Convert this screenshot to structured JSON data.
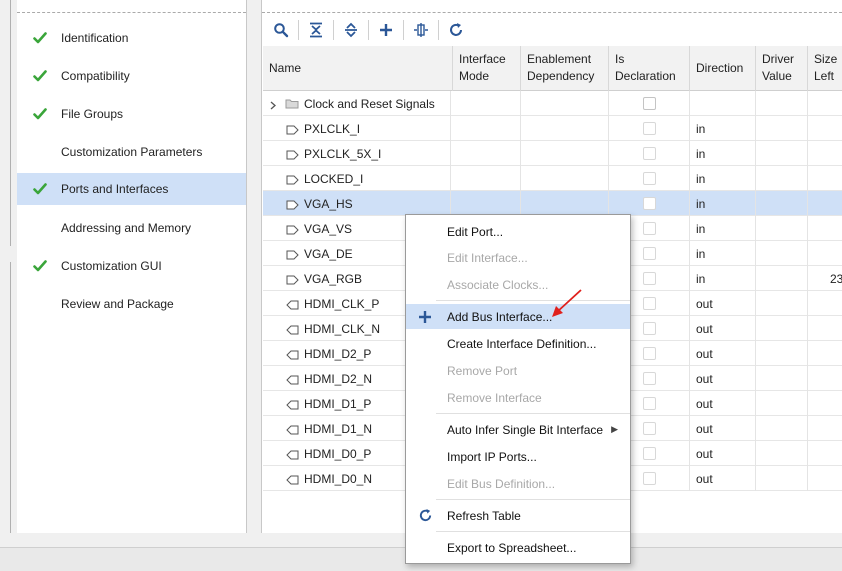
{
  "nav": {
    "items": [
      {
        "label": "Identification",
        "checked": true
      },
      {
        "label": "Compatibility",
        "checked": true
      },
      {
        "label": "File Groups",
        "checked": true
      },
      {
        "label": "Customization Parameters",
        "checked": false
      },
      {
        "label": "Ports and Interfaces",
        "checked": true,
        "selected": true
      },
      {
        "label": "Addressing and Memory",
        "checked": false
      },
      {
        "label": "Customization GUI",
        "checked": true
      },
      {
        "label": "Review and Package",
        "checked": false
      }
    ]
  },
  "toolbar": {
    "icons": [
      "search-icon",
      "collapse-all-icon",
      "expand-all-icon",
      "add-icon",
      "map-icon",
      "refresh-icon"
    ]
  },
  "table": {
    "headers": {
      "name": "Name",
      "interface_mode_1": "Interface",
      "interface_mode_2": "Mode",
      "enablement_1": "Enablement",
      "enablement_2": "Dependency",
      "is_decl_1": "Is",
      "is_decl_2": "Declaration",
      "direction": "Direction",
      "driver_1": "Driver",
      "driver_2": "Value",
      "size_1": "Size",
      "size_2": "Left"
    },
    "rows": [
      {
        "name": "Clock and Reset Signals",
        "kind": "group",
        "direction": "",
        "size_left": ""
      },
      {
        "name": "PXLCLK_I",
        "kind": "in",
        "direction": "in",
        "size_left": ""
      },
      {
        "name": "PXLCLK_5X_I",
        "kind": "in",
        "direction": "in",
        "size_left": ""
      },
      {
        "name": "LOCKED_I",
        "kind": "in",
        "direction": "in",
        "size_left": ""
      },
      {
        "name": "VGA_HS",
        "kind": "in",
        "direction": "in",
        "size_left": "",
        "selected": true
      },
      {
        "name": "VGA_VS",
        "kind": "in",
        "direction": "in",
        "size_left": ""
      },
      {
        "name": "VGA_DE",
        "kind": "in",
        "direction": "in",
        "size_left": ""
      },
      {
        "name": "VGA_RGB",
        "kind": "in",
        "direction": "in",
        "size_left": "23"
      },
      {
        "name": "HDMI_CLK_P",
        "kind": "out",
        "direction": "out",
        "size_left": ""
      },
      {
        "name": "HDMI_CLK_N",
        "kind": "out",
        "direction": "out",
        "size_left": ""
      },
      {
        "name": "HDMI_D2_P",
        "kind": "out",
        "direction": "out",
        "size_left": ""
      },
      {
        "name": "HDMI_D2_N",
        "kind": "out",
        "direction": "out",
        "size_left": ""
      },
      {
        "name": "HDMI_D1_P",
        "kind": "out",
        "direction": "out",
        "size_left": ""
      },
      {
        "name": "HDMI_D1_N",
        "kind": "out",
        "direction": "out",
        "size_left": ""
      },
      {
        "name": "HDMI_D0_P",
        "kind": "out",
        "direction": "out",
        "size_left": ""
      },
      {
        "name": "HDMI_D0_N",
        "kind": "out",
        "direction": "out",
        "size_left": ""
      }
    ]
  },
  "menu": {
    "edit_port": "Edit Port...",
    "edit_interface": "Edit Interface...",
    "associate_clocks": "Associate Clocks...",
    "add_bus_interface": "Add Bus Interface...",
    "create_interface_definition": "Create Interface Definition...",
    "remove_port": "Remove Port",
    "remove_interface": "Remove Interface",
    "auto_infer": "Auto Infer Single Bit Interface",
    "import_ip_ports": "Import IP Ports...",
    "edit_bus_definition": "Edit Bus Definition...",
    "refresh_table": "Refresh Table",
    "export_to_spreadsheet": "Export to Spreadsheet..."
  },
  "colors": {
    "selection": "#cfe0f7",
    "check_green": "#3aa53a",
    "icon_blue": "#2b5797",
    "annotation_red": "#e0201c"
  }
}
